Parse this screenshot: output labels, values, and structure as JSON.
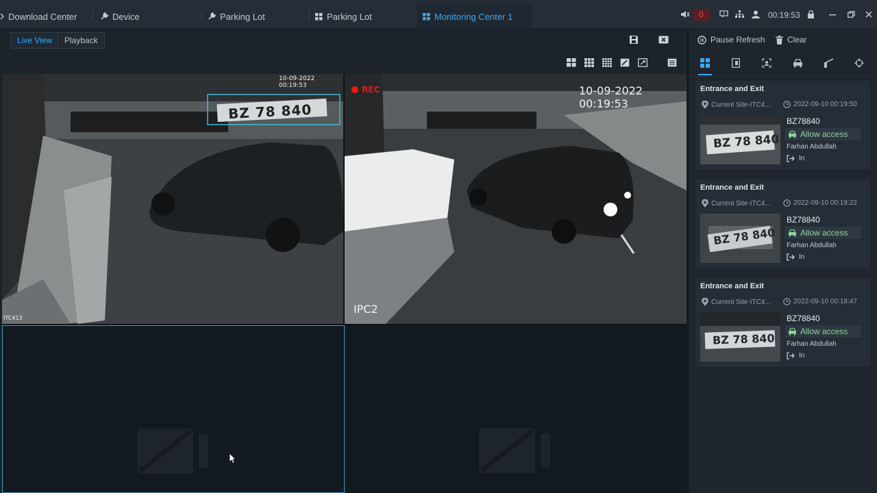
{
  "tabs": [
    {
      "label": "Download Center",
      "icon": "download-icon"
    },
    {
      "label": "Device",
      "icon": "wrench-icon"
    },
    {
      "label": "Parking Lot",
      "icon": "wrench-icon"
    },
    {
      "label": "Parking Lot",
      "icon": "grid-icon"
    },
    {
      "label": "Monitoring Center 1",
      "icon": "grid-icon",
      "active": true
    }
  ],
  "system": {
    "alarm_count": "0",
    "time": "00:19:53"
  },
  "view_toggle": {
    "live_label": "Live View",
    "playback_label": "Playback"
  },
  "cameras": [
    {
      "name": "ITC413",
      "timestamp": "10-09-2022 00:19:53",
      "plate_overlay": "BZ 78 840",
      "rec": false
    },
    {
      "name": "IPC2",
      "timestamp": "10-09-2022 00:19:53",
      "rec_label": "REC",
      "rec": true
    },
    {
      "name": "",
      "empty": true
    },
    {
      "name": "",
      "empty": true
    }
  ],
  "right_panel": {
    "pause_label": "Pause Refresh",
    "clear_label": "Clear",
    "events": [
      {
        "title": "Entrance and Exit",
        "site": "Current Site-ITC4...",
        "time": "2022-09-10 00:19:50",
        "plate": "BZ78840",
        "thumb_plate": "BZ 78 840",
        "access": "Allow access",
        "owner": "Farhan Abdullah",
        "direction": "In"
      },
      {
        "title": "Entrance and Exit",
        "site": "Current Site-ITC4...",
        "time": "2022-09-10 00:19:22",
        "plate": "BZ78840",
        "thumb_plate": "BZ 78 840",
        "access": "Allow access",
        "owner": "Farhan Abdullah",
        "direction": "In"
      },
      {
        "title": "Entrance and Exit",
        "site": "Current Site-ITC4...",
        "time": "2022-09-10 00:18:47",
        "plate": "BZ78840",
        "thumb_plate": "BZ 78 840",
        "access": "Allow access",
        "owner": "Farhan Abdullah",
        "direction": "In"
      }
    ]
  },
  "colors": {
    "accent": "#3ea7f5",
    "allow": "#8fd49a",
    "alarm": "#e84a4a",
    "selection": "#3aa0c8"
  }
}
